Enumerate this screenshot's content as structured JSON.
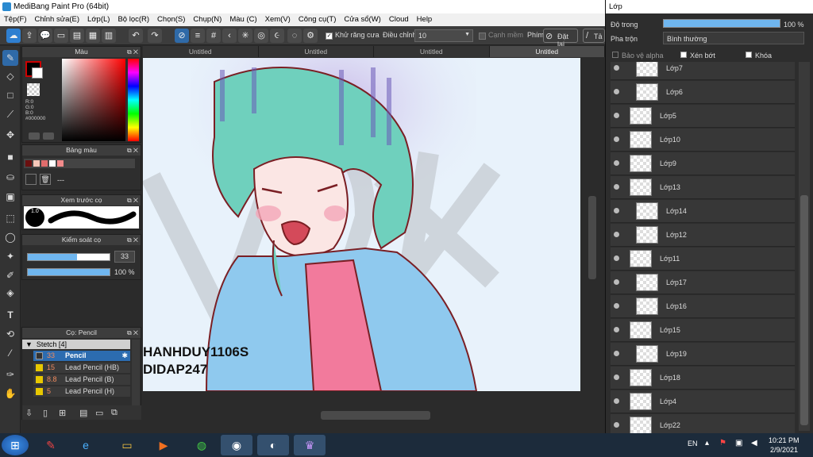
{
  "window": {
    "title": "MediBang Paint Pro (64bit)"
  },
  "menu": [
    "Tệp(F)",
    "Chỉnh sửa(E)",
    "Lớp(L)",
    "Bộ lọc(R)",
    "Chọn(S)",
    "Chụp(N)",
    "Màu (C)",
    "Xem(V)",
    "Công cụ(T)",
    "Cửa sổ(W)",
    "Cloud",
    "Help"
  ],
  "toolbar": {
    "antialias_label": "Khử răng cưa",
    "adjust_label": "Điều chỉnh",
    "adjust_value": "10",
    "edge_label": "Cạnh mềm",
    "key_label": "Phím",
    "reset_label": "Đặt lại",
    "extra_label": "Tả"
  },
  "panels": {
    "color": {
      "title": "Màu",
      "r": "R:0",
      "g": "G:0",
      "b": "B:0",
      "hex": "#000000"
    },
    "palette": {
      "title": "Bảng màu",
      "extra": "---"
    },
    "brush_preview": {
      "title": "Xem trước cọ",
      "size": "1.0"
    },
    "brush_control": {
      "title": "Kiểm soát cọ",
      "size": "33",
      "opacity": "100 %"
    },
    "brush_list": {
      "title": "Cọ: Pencil",
      "group": "Stetch [4]",
      "items": [
        {
          "size": "33",
          "name": "Pencil",
          "color": "#333333",
          "selected": true
        },
        {
          "size": "15",
          "name": "Lead Pencil (HB)",
          "color": "#e8c800",
          "selected": false
        },
        {
          "size": "8.8",
          "name": "Lead Pencil (B)",
          "color": "#e8c800",
          "selected": false
        },
        {
          "size": "5",
          "name": "Lead Pencil (H)",
          "color": "#e8c800",
          "selected": false
        }
      ]
    }
  },
  "tabs": [
    "Untitled",
    "Untitled",
    "Untitled",
    "Untitled"
  ],
  "canvas": {
    "watermark_line1": "HANHDUY1106S",
    "watermark_line2": "DIDAP247"
  },
  "layers_panel": {
    "title": "Lớp",
    "opacity_label": "Độ trong",
    "opacity_value": "100 %",
    "blend_label": "Pha trộn",
    "blend_value": "Bình thường",
    "protect_alpha": "Bảo vệ alpha",
    "clipping": "Xén bớt",
    "lock": "Khóa",
    "layers": [
      {
        "name": "Lớp7",
        "indent": true
      },
      {
        "name": "Lớp6",
        "indent": true
      },
      {
        "name": "Lớp5",
        "indent": false
      },
      {
        "name": "Lớp10",
        "indent": false
      },
      {
        "name": "Lớp9",
        "indent": false
      },
      {
        "name": "Lớp13",
        "indent": false
      },
      {
        "name": "Lớp14",
        "indent": true
      },
      {
        "name": "Lớp12",
        "indent": true
      },
      {
        "name": "Lớp11",
        "indent": false
      },
      {
        "name": "Lớp17",
        "indent": true
      },
      {
        "name": "Lớp16",
        "indent": true
      },
      {
        "name": "Lớp15",
        "indent": false
      },
      {
        "name": "Lớp19",
        "indent": true
      },
      {
        "name": "Lớp18",
        "indent": false
      },
      {
        "name": "Lớp4",
        "indent": false
      },
      {
        "name": "Lớp22",
        "indent": false
      }
    ]
  },
  "taskbar": {
    "lang": "EN",
    "time": "10:21 PM",
    "date": "2/9/2021"
  }
}
